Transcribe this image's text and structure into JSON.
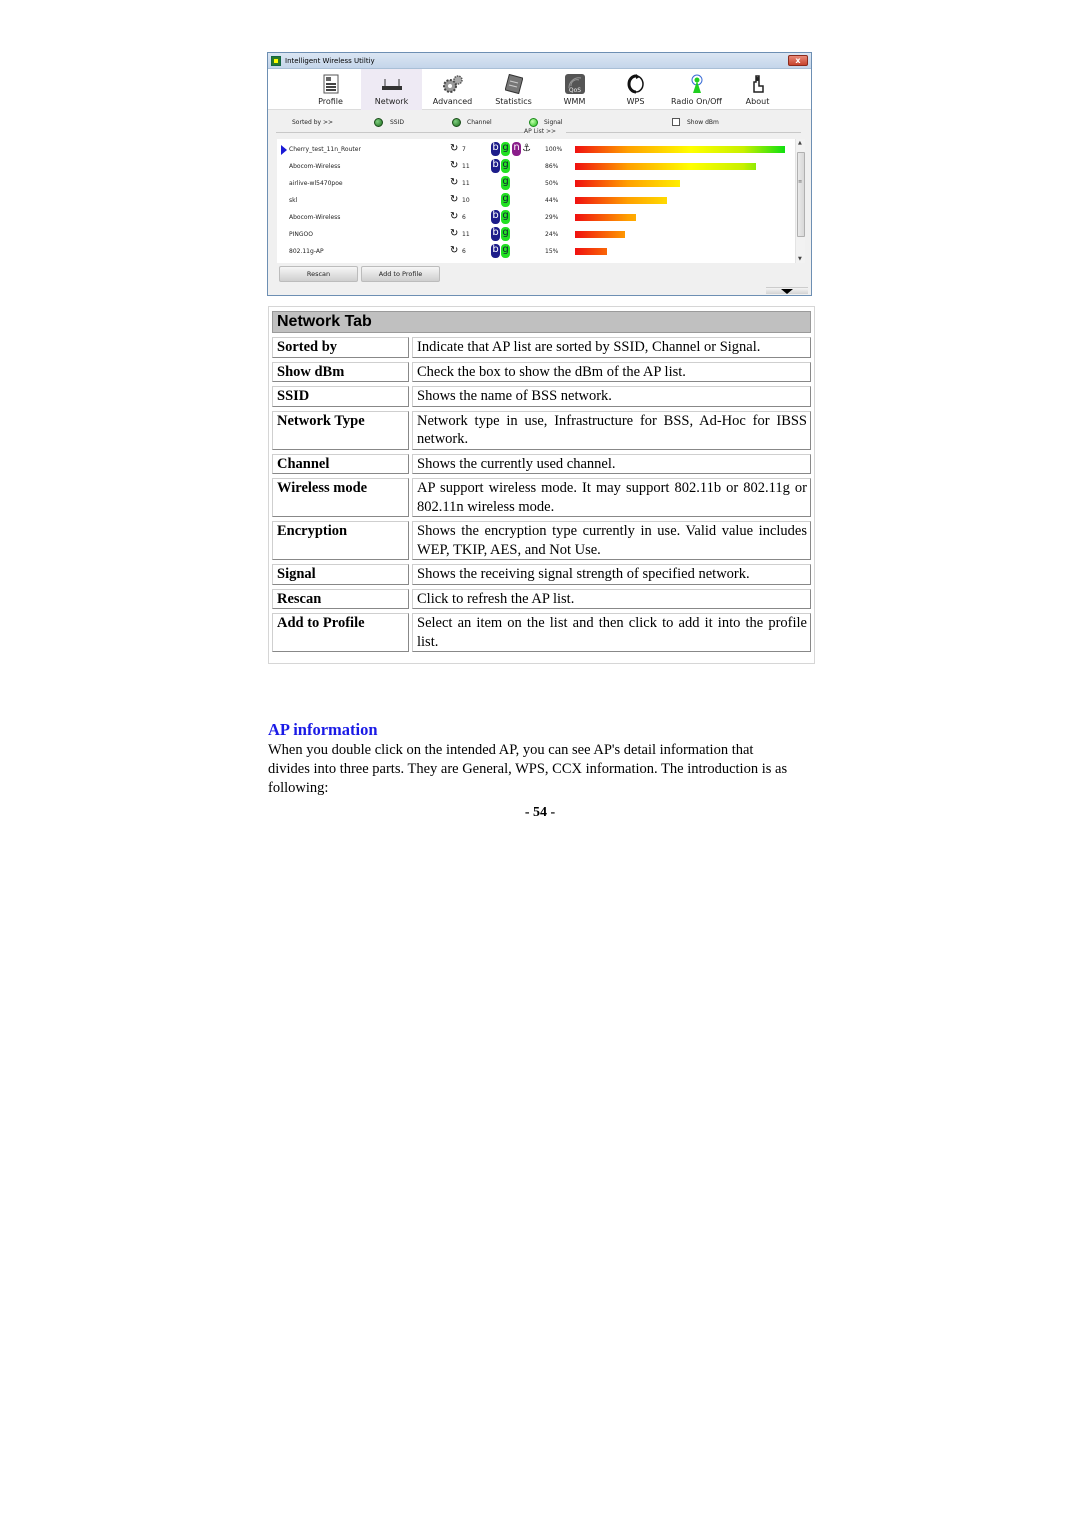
{
  "window": {
    "title": "Intelligent Wireless Utiltiy",
    "close_label": "x",
    "toolbar": [
      {
        "label": "Profile",
        "icon": "profile-icon",
        "active": false
      },
      {
        "label": "Network",
        "icon": "router-icon",
        "active": true
      },
      {
        "label": "Advanced",
        "icon": "gears-icon",
        "active": false
      },
      {
        "label": "Statistics",
        "icon": "statistics-icon",
        "active": false
      },
      {
        "label": "WMM",
        "icon": "qos-icon",
        "active": false
      },
      {
        "label": "WPS",
        "icon": "wps-icon",
        "active": false
      },
      {
        "label": "Radio On/Off",
        "icon": "radio-antenna-icon",
        "active": false
      },
      {
        "label": "About",
        "icon": "about-icon",
        "active": false
      }
    ],
    "sortbar": {
      "sorted_by_label": "Sorted by >>",
      "options": [
        {
          "label": "SSID",
          "selected": true
        },
        {
          "label": "Channel",
          "selected": true
        },
        {
          "label": "Signal",
          "selected": true
        }
      ],
      "show_dbm_label": "Show dBm",
      "show_dbm_checked": false,
      "ap_list_label": "AP List >>"
    },
    "ap_list": [
      {
        "ssid": "Cherry_test_11n_Router",
        "channel": "7",
        "modes": [
          "b",
          "g",
          "n"
        ],
        "encrypted": true,
        "signal_pct": 100,
        "signal_label": "100%",
        "selected": true
      },
      {
        "ssid": "Abocom-Wireless",
        "channel": "11",
        "modes": [
          "b",
          "g"
        ],
        "encrypted": false,
        "signal_pct": 86,
        "signal_label": "86%",
        "selected": false
      },
      {
        "ssid": "airlive-wl5470poe",
        "channel": "11",
        "modes": [
          "g"
        ],
        "encrypted": false,
        "signal_pct": 50,
        "signal_label": "50%",
        "selected": false
      },
      {
        "ssid": "skl",
        "channel": "10",
        "modes": [
          "g"
        ],
        "encrypted": false,
        "signal_pct": 44,
        "signal_label": "44%",
        "selected": false
      },
      {
        "ssid": "Abocom-Wireless",
        "channel": "6",
        "modes": [
          "b",
          "g"
        ],
        "encrypted": false,
        "signal_pct": 29,
        "signal_label": "29%",
        "selected": false
      },
      {
        "ssid": "PINGOO",
        "channel": "11",
        "modes": [
          "b",
          "g"
        ],
        "encrypted": false,
        "signal_pct": 24,
        "signal_label": "24%",
        "selected": false
      },
      {
        "ssid": "802.11g-AP",
        "channel": "6",
        "modes": [
          "b",
          "g"
        ],
        "encrypted": false,
        "signal_pct": 15,
        "signal_label": "15%",
        "selected": false
      }
    ],
    "buttons": {
      "rescan": "Rescan",
      "add_to_profile": "Add to Profile"
    }
  },
  "table": {
    "title": "Network Tab",
    "rows": [
      {
        "term": "Sorted by",
        "desc": "Indicate that AP list are sorted by SSID, Channel or Signal."
      },
      {
        "term": "Show dBm",
        "desc": "Check the box to show the dBm of the AP list."
      },
      {
        "term": "SSID",
        "desc": "Shows the name of BSS network."
      },
      {
        "term": "Network Type",
        "desc": "Network type in use, Infrastructure for BSS, Ad-Hoc for IBSS network."
      },
      {
        "term": "Channel",
        "desc": "Shows the currently used channel."
      },
      {
        "term": "Wireless mode",
        "desc": "AP support wireless mode. It may support 802.11b or 802.11g or 802.11n wireless mode."
      },
      {
        "term": "Encryption",
        "desc": "Shows the encryption type currently in use. Valid value includes WEP, TKIP, AES, and Not Use."
      },
      {
        "term": "Signal",
        "desc": "Shows the receiving signal strength of specified network."
      },
      {
        "term": "Rescan",
        "desc": "Click to refresh the AP list."
      },
      {
        "term": "Add to Profile",
        "desc": "Select an item on the list and then click to add it into the profile list."
      }
    ]
  },
  "section": {
    "heading": "AP information",
    "paragraph": "When you double click on the intended AP, you can see AP's detail information that divides into three parts. They are General, WPS, CCX information. The introduction is as following:"
  },
  "page_number": "- 54 -"
}
